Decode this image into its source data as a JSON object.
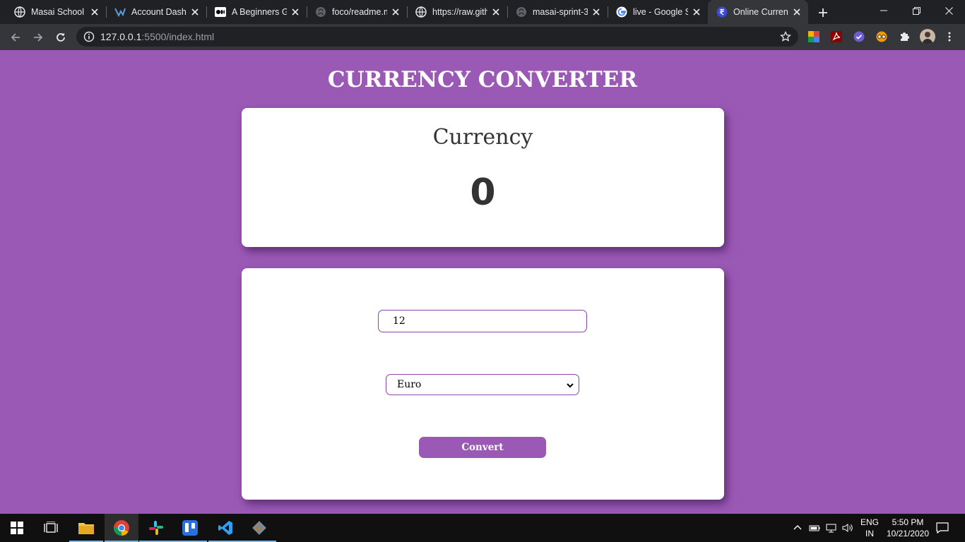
{
  "browser": {
    "tabs": [
      {
        "title": "Masai School",
        "icon": "globe-icon"
      },
      {
        "title": "Account Dashb",
        "icon": "vercel-icon"
      },
      {
        "title": "A Beginners Gu",
        "icon": "medium-icon"
      },
      {
        "title": "foco/readme.m",
        "icon": "github-icon"
      },
      {
        "title": "https://raw.gith",
        "icon": "globe-icon"
      },
      {
        "title": "masai-sprint-3",
        "icon": "github-icon"
      },
      {
        "title": "live - Google S",
        "icon": "google-icon"
      },
      {
        "title": "Online Curren",
        "icon": "rupee-icon",
        "active": true
      }
    ],
    "url_host": "127.0.0.1",
    "url_path": ":5500/index.html"
  },
  "page": {
    "title": "CURRENCY CONVERTER",
    "result_label": "Currency",
    "result_value": "0",
    "amount_value": "12",
    "currency_selected": "Euro",
    "convert_label": "Convert"
  },
  "taskbar": {
    "lang_top": "ENG",
    "lang_bottom": "IN",
    "time": "5:50 PM",
    "date": "10/21/2020"
  },
  "colors": {
    "page_bg": "#9b59b6",
    "accent": "#8e44ad"
  }
}
